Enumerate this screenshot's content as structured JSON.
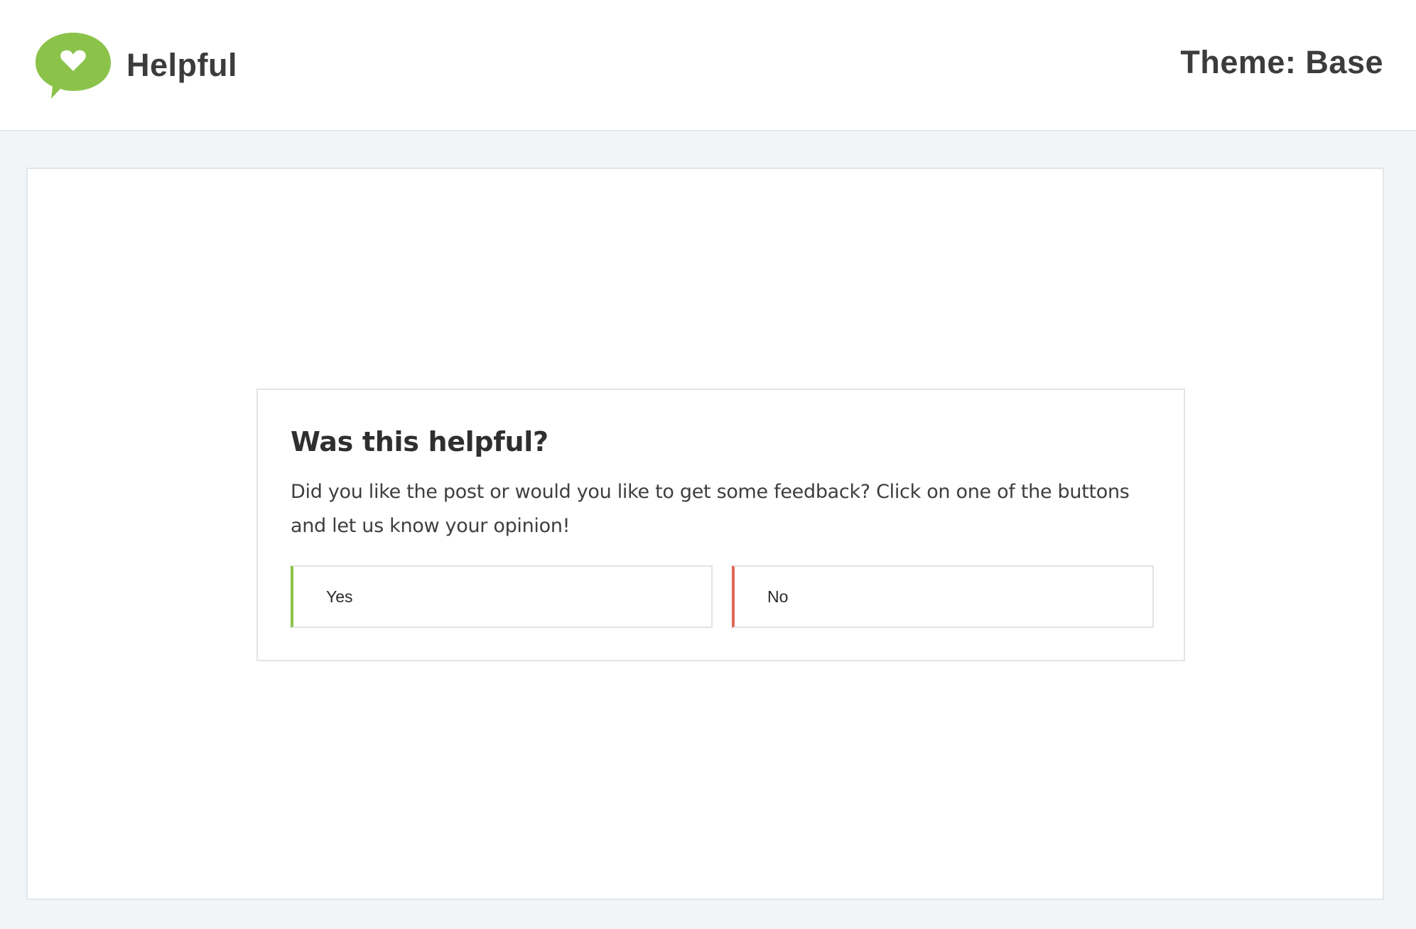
{
  "header": {
    "brand_name": "Helpful",
    "theme_label": "Theme: Base",
    "logo_icon": "heart-speech-bubble-icon",
    "logo_color": "#8bc34a"
  },
  "helpful_box": {
    "heading": "Was this helpful?",
    "text": "Did you like the post or would you like to get some feedback? Click on one of the buttons and let us know your opinion!",
    "yes_label": "Yes",
    "no_label": "No",
    "yes_accent": "#8bc34a",
    "no_accent": "#e0685a"
  }
}
